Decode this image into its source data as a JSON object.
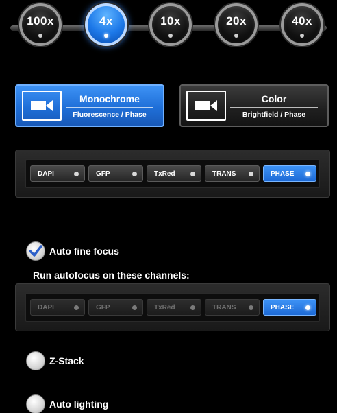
{
  "objectives": [
    {
      "label": "100x",
      "selected": false
    },
    {
      "label": "4x",
      "selected": true
    },
    {
      "label": "10x",
      "selected": false
    },
    {
      "label": "20x",
      "selected": false
    },
    {
      "label": "40x",
      "selected": false
    }
  ],
  "modes": {
    "mono": {
      "title": "Monochrome",
      "subtitle": "Fluorescence / Phase",
      "selected": true
    },
    "color": {
      "title": "Color",
      "subtitle": "Brightfield / Phase",
      "selected": false
    }
  },
  "channels": [
    {
      "label": "DAPI",
      "on": false
    },
    {
      "label": "GFP",
      "on": false
    },
    {
      "label": "TxRed",
      "on": false
    },
    {
      "label": "TRANS",
      "on": false
    },
    {
      "label": "PHASE",
      "on": true
    }
  ],
  "autofocus": {
    "label": "Auto fine focus",
    "checked": true,
    "channels_label": "Run autofocus on these channels:",
    "channels": [
      {
        "label": "DAPI",
        "on": false
      },
      {
        "label": "GFP",
        "on": false
      },
      {
        "label": "TxRed",
        "on": false
      },
      {
        "label": "TRANS",
        "on": false
      },
      {
        "label": "PHASE",
        "on": true
      }
    ]
  },
  "zstack": {
    "label": "Z-Stack",
    "checked": false
  },
  "auto_lighting": {
    "label": "Auto lighting",
    "checked": false
  },
  "colors": {
    "accent": "#1f6fd8",
    "panel": "#1e1e1e",
    "background": "#000000"
  }
}
